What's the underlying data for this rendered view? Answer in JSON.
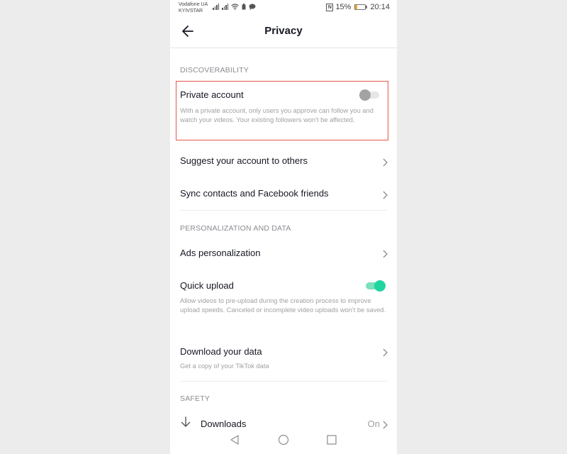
{
  "status_bar": {
    "carrier_line1": "Vodafone UA",
    "carrier_line2": "KYIVSTAR",
    "nfc_label": "N",
    "battery_percent_text": "15%",
    "battery_level": 0.15,
    "time": "20:14"
  },
  "header": {
    "title": "Privacy",
    "back_icon": "arrow-left-icon"
  },
  "sections": {
    "discoverability": {
      "label": "DISCOVERABILITY",
      "private_account": {
        "title": "Private account",
        "description": "With a private account, only users you approve can follow you and watch your videos. Your existing followers won't be affected.",
        "enabled": false
      },
      "suggest_account": {
        "title": "Suggest your account to others"
      },
      "sync_contacts": {
        "title": "Sync contacts and Facebook friends"
      }
    },
    "personalization": {
      "label": "PERSONALIZATION AND DATA",
      "ads_personalization": {
        "title": "Ads personalization"
      },
      "quick_upload": {
        "title": "Quick upload",
        "description": "Allow videos to pre-upload during the creation process to improve upload speeds. Canceled or incomplete video uploads won't be saved.",
        "enabled": true
      },
      "download_data": {
        "title": "Download your data",
        "description": "Get a copy of your TikTok data"
      }
    },
    "safety": {
      "label": "SAFETY",
      "downloads": {
        "title": "Downloads",
        "value": "On",
        "icon": "download-arrow-icon"
      }
    }
  },
  "colors": {
    "highlight_border": "#e2574c",
    "toggle_on": "#20d5a0",
    "toggle_off": "#a3a3a6"
  },
  "nav_bar": {
    "back": "triangle-back-icon",
    "home": "circle-home-icon",
    "recents": "square-recents-icon"
  }
}
